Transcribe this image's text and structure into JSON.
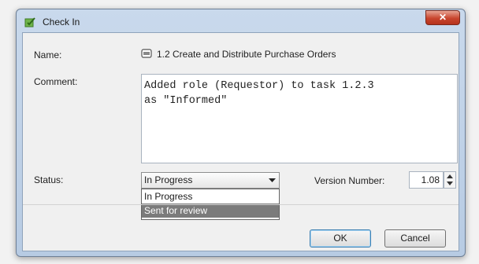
{
  "window": {
    "title": "Check In",
    "close_glyph": "✕"
  },
  "form": {
    "name_label": "Name:",
    "name_value": "1.2 Create and Distribute Purchase Orders",
    "comment_label": "Comment:",
    "comment_value": "Added role (Requestor) to task 1.2.3\nas \"Informed\"",
    "status_label": "Status:",
    "status_selected": "In Progress",
    "status_options": [
      "In Progress",
      "Sent for review"
    ],
    "version_label": "Version Number:",
    "version_value": "1.08"
  },
  "buttons": {
    "ok": "OK",
    "cancel": "Cancel"
  },
  "colors": {
    "title_bar": "#c9d9ec",
    "close_button": "#c8452e",
    "highlight": "#7b7b7b"
  }
}
